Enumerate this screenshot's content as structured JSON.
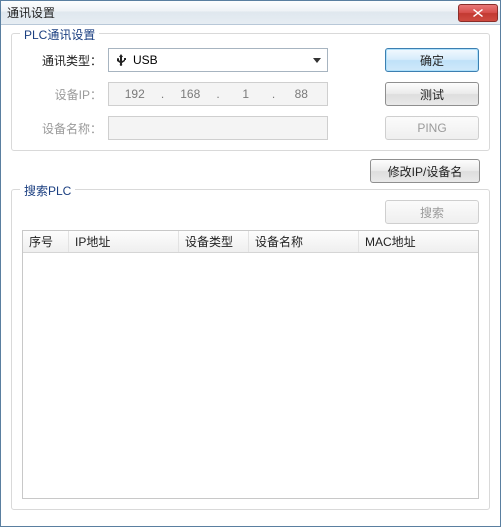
{
  "window": {
    "title": "通讯设置"
  },
  "group_plc": {
    "legend": "PLC通讯设置",
    "labels": {
      "comm_type": "通讯类型：",
      "device_ip": "设备IP：",
      "device_name": "设备名称："
    },
    "comm_type_value": "USB",
    "ip": {
      "a": "192",
      "b": "168",
      "c": "1",
      "d": "88"
    },
    "device_name_value": ""
  },
  "buttons": {
    "ok": "确定",
    "test": "测试",
    "ping": "PING",
    "modify": "修改IP/设备名",
    "search": "搜索"
  },
  "group_search": {
    "legend": "搜索PLC"
  },
  "table": {
    "cols": {
      "index": "序号",
      "ip": "IP地址",
      "type": "设备类型",
      "name": "设备名称",
      "mac": "MAC地址"
    },
    "rows": []
  }
}
